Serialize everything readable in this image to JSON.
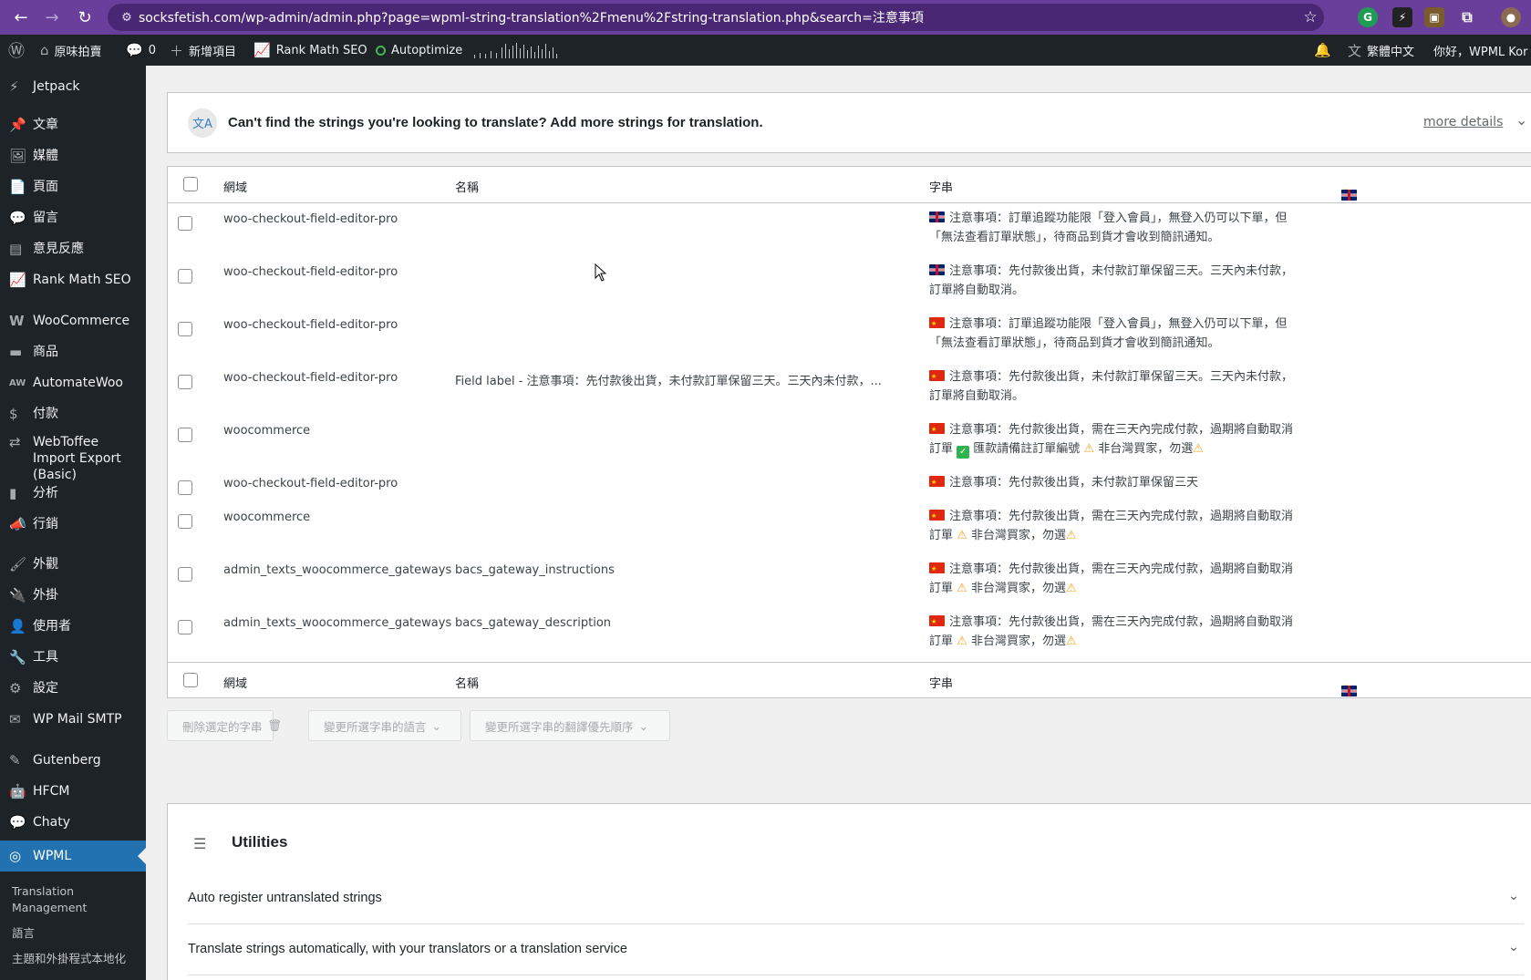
{
  "browser": {
    "url": "socksfetish.com/wp-admin/admin.php?page=wpml-string-translation%2Fmenu%2Fstring-translation.php&search=注意事項"
  },
  "adminbar": {
    "site": "原味拍賣",
    "comments": "0",
    "new": "新增項目",
    "rankmath": "Rank Math SEO",
    "autoptimize": "Autoptimize",
    "lang": "繁體中文",
    "greeting": "你好，WPML Kor"
  },
  "sidebar": {
    "items": [
      {
        "label": "Jetpack",
        "icon": "jetpack-icon"
      },
      {
        "label": "文章",
        "icon": "pin-icon"
      },
      {
        "label": "媒體",
        "icon": "media-icon"
      },
      {
        "label": "頁面",
        "icon": "page-icon"
      },
      {
        "label": "留言",
        "icon": "comment-icon"
      },
      {
        "label": "意見反應",
        "icon": "feedback-icon"
      },
      {
        "label": "Rank Math SEO",
        "icon": "rankmath-icon"
      },
      {
        "label": "WooCommerce",
        "icon": "woo-icon"
      },
      {
        "label": "商品",
        "icon": "products-icon"
      },
      {
        "label": "AutomateWoo",
        "icon": "aw-icon"
      },
      {
        "label": "付款",
        "icon": "payments-icon"
      },
      {
        "label": "WebToffee Import Export (Basic)",
        "icon": "import-icon"
      },
      {
        "label": "分析",
        "icon": "analytics-icon"
      },
      {
        "label": "行銷",
        "icon": "marketing-icon"
      },
      {
        "label": "外觀",
        "icon": "appearance-icon"
      },
      {
        "label": "外掛",
        "icon": "plugins-icon"
      },
      {
        "label": "使用者",
        "icon": "users-icon"
      },
      {
        "label": "工具",
        "icon": "tools-icon"
      },
      {
        "label": "設定",
        "icon": "settings-icon"
      },
      {
        "label": "WP Mail SMTP",
        "icon": "mail-icon"
      },
      {
        "label": "Gutenberg",
        "icon": "gutenberg-icon"
      },
      {
        "label": "HFCM",
        "icon": "hfcm-icon"
      },
      {
        "label": "Chaty",
        "icon": "chaty-icon"
      },
      {
        "label": "WPML",
        "icon": "wpml-icon"
      }
    ],
    "submenu": [
      "Translation Management",
      "語言",
      "主題和外掛程式本地化"
    ]
  },
  "notice": {
    "text": "Can't find the strings you're looking to translate? Add more strings for translation.",
    "more": "more details"
  },
  "table": {
    "headers": {
      "domain": "網域",
      "name": "名稱",
      "string": "字串"
    },
    "rows": [
      {
        "domain": "woo-checkout-field-editor-pro",
        "name": "",
        "flag": "uk",
        "line1": "注意事項：訂單追蹤功能限「登入會員」，無登入仍可以下單，但",
        "line2": "「無法查看訂單狀態」，待商品到貨才會收到簡訊通知。"
      },
      {
        "domain": "woo-checkout-field-editor-pro",
        "name": "",
        "flag": "uk",
        "line1": "注意事項：先付款後出貨，未付款訂單保留三天。三天內未付款，",
        "line2": "訂單將自動取消。"
      },
      {
        "domain": "woo-checkout-field-editor-pro",
        "name": "",
        "flag": "cn",
        "line1": "注意事項：訂單追蹤功能限「登入會員」，無登入仍可以下單，但",
        "line2": "「無法查看訂單狀態」，待商品到貨才會收到簡訊通知。"
      },
      {
        "domain": "woo-checkout-field-editor-pro",
        "name": "Field label - 注意事項：先付款後出貨，未付款訂單保留三天。三天內未付款，...",
        "flag": "cn",
        "line1": "注意事項：先付款後出貨，未付款訂單保留三天。三天內未付款，",
        "line2": "訂單將自動取消。"
      },
      {
        "domain": "woocommerce",
        "name": "",
        "flag": "cn",
        "line1": "注意事項：先付款後出貨，需在三天內完成付款，過期將自動取消",
        "line2a": "訂單",
        "line2b": "匯款請備註訂單編號",
        "line2c": "非台灣買家，勿選"
      },
      {
        "domain": "woo-checkout-field-editor-pro",
        "name": "",
        "flag": "cn",
        "line1": "注意事項：先付款後出貨，未付款訂單保留三天",
        "line2": ""
      },
      {
        "domain": "woocommerce",
        "name": "",
        "flag": "cn",
        "line1": "注意事項：先付款後出貨，需在三天內完成付款，過期將自動取消",
        "line2a": "訂單",
        "line2c": "非台灣買家，勿選"
      },
      {
        "domain": "admin_texts_woocommerce_gateways",
        "name": "bacs_gateway_instructions",
        "flag": "cn",
        "line1": "注意事項：先付款後出貨，需在三天內完成付款，過期將自動取消",
        "line2a": "訂單",
        "line2c": "非台灣買家，勿選"
      },
      {
        "domain": "admin_texts_woocommerce_gateways",
        "name": "bacs_gateway_description",
        "flag": "cn",
        "line1": "注意事項：先付款後出貨，需在三天內完成付款，過期將自動取消",
        "line2a": "訂單",
        "line2c": "非台灣買家，勿選"
      }
    ]
  },
  "bulk": {
    "delete": "刪除選定的字串",
    "lang": "變更所選字串的語言",
    "priority": "變更所選字串的翻譯優先順序"
  },
  "utilities": {
    "title": "Utilities",
    "auto_register": "Auto register untranslated strings",
    "translate_auto": "Translate strings automatically, with your translators or a translation service"
  }
}
